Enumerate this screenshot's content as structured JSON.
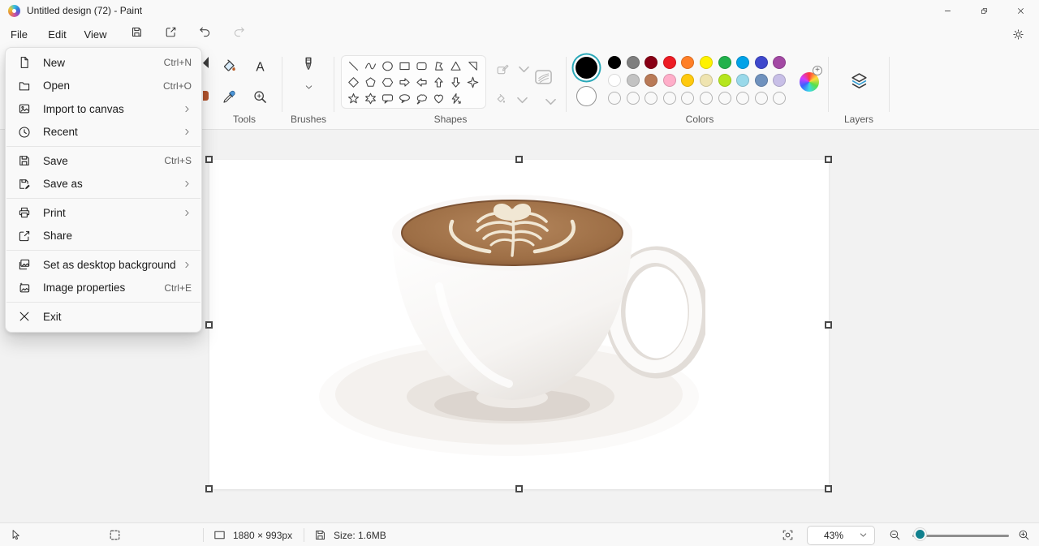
{
  "window": {
    "title": "Untitled design (72) - Paint"
  },
  "menubar": {
    "items": [
      "File",
      "Edit",
      "View"
    ]
  },
  "quick_actions": [
    {
      "icon": "floppy",
      "name": "save",
      "enabled": true
    },
    {
      "icon": "share-box",
      "name": "share",
      "enabled": true
    },
    {
      "icon": "undo",
      "name": "undo",
      "enabled": true
    },
    {
      "icon": "redo",
      "name": "redo",
      "enabled": false
    }
  ],
  "file_menu": {
    "items": [
      {
        "icon": "new-document",
        "label": "New",
        "shortcut": "Ctrl+N"
      },
      {
        "icon": "open-folder",
        "label": "Open",
        "shortcut": "Ctrl+O"
      },
      {
        "icon": "import-image",
        "label": "Import to canvas",
        "submenu": true
      },
      {
        "icon": "clock",
        "label": "Recent",
        "submenu": true,
        "separator_after": true
      },
      {
        "icon": "floppy",
        "label": "Save",
        "shortcut": "Ctrl+S"
      },
      {
        "icon": "floppy-edit",
        "label": "Save as",
        "submenu": true,
        "separator_after": true
      },
      {
        "icon": "printer",
        "label": "Print",
        "submenu": true
      },
      {
        "icon": "share-box",
        "label": "Share",
        "separator_after": true
      },
      {
        "icon": "desktop-image",
        "label": "Set as desktop background",
        "submenu": true
      },
      {
        "icon": "image-sparkle",
        "label": "Image properties",
        "shortcut": "Ctrl+E",
        "separator_after": true
      },
      {
        "icon": "close-x",
        "label": "Exit"
      }
    ]
  },
  "ribbon": {
    "tools": {
      "label": "Tools",
      "icons": [
        "fill-bucket",
        "text-tool",
        "eyedropper",
        "magnifier"
      ]
    },
    "brushes": {
      "label": "Brushes",
      "icon": "brush"
    },
    "shapes": {
      "label": "Shapes",
      "icons": [
        "line",
        "curve",
        "ellipse",
        "rectangle",
        "rounded-rectangle",
        "polygon",
        "triangle",
        "right-triangle",
        "diamond",
        "pentagon",
        "hexagon",
        "arrow-right",
        "arrow-left",
        "arrow-up",
        "arrow-down",
        "star-four",
        "star-five",
        "star-six",
        "speech-rounded",
        "speech-oval",
        "thought-bubble",
        "heart",
        "lightning"
      ],
      "options": [
        "shape-outline",
        "stroke-size",
        "shape-fill"
      ]
    },
    "colors": {
      "label": "Colors",
      "foreground": "#000000",
      "background": "#ffffff",
      "selected_ring": "#2aa8b8",
      "row1": [
        "#000000",
        "#7f7f7f",
        "#880015",
        "#ed1c24",
        "#ff7f27",
        "#fff200",
        "#22b14c",
        "#00a2e8",
        "#3f48cc",
        "#a349a4"
      ],
      "row2": [
        "#ffffff",
        "#c3c3c3",
        "#b97a57",
        "#ffaec9",
        "#ffc90e",
        "#efe4b0",
        "#b5e61d",
        "#99d9ea",
        "#7092be",
        "#c8bfe7"
      ],
      "row3": [
        "",
        "",
        "",
        "",
        "",
        "",
        "",
        "",
        "",
        ""
      ]
    },
    "layers": {
      "label": "Layers"
    }
  },
  "statusbar": {
    "canvas_size": "1880 × 993px",
    "file_size": "Size: 1.6MB",
    "zoom_value": "43%",
    "accent_thumb": "#10808e"
  }
}
